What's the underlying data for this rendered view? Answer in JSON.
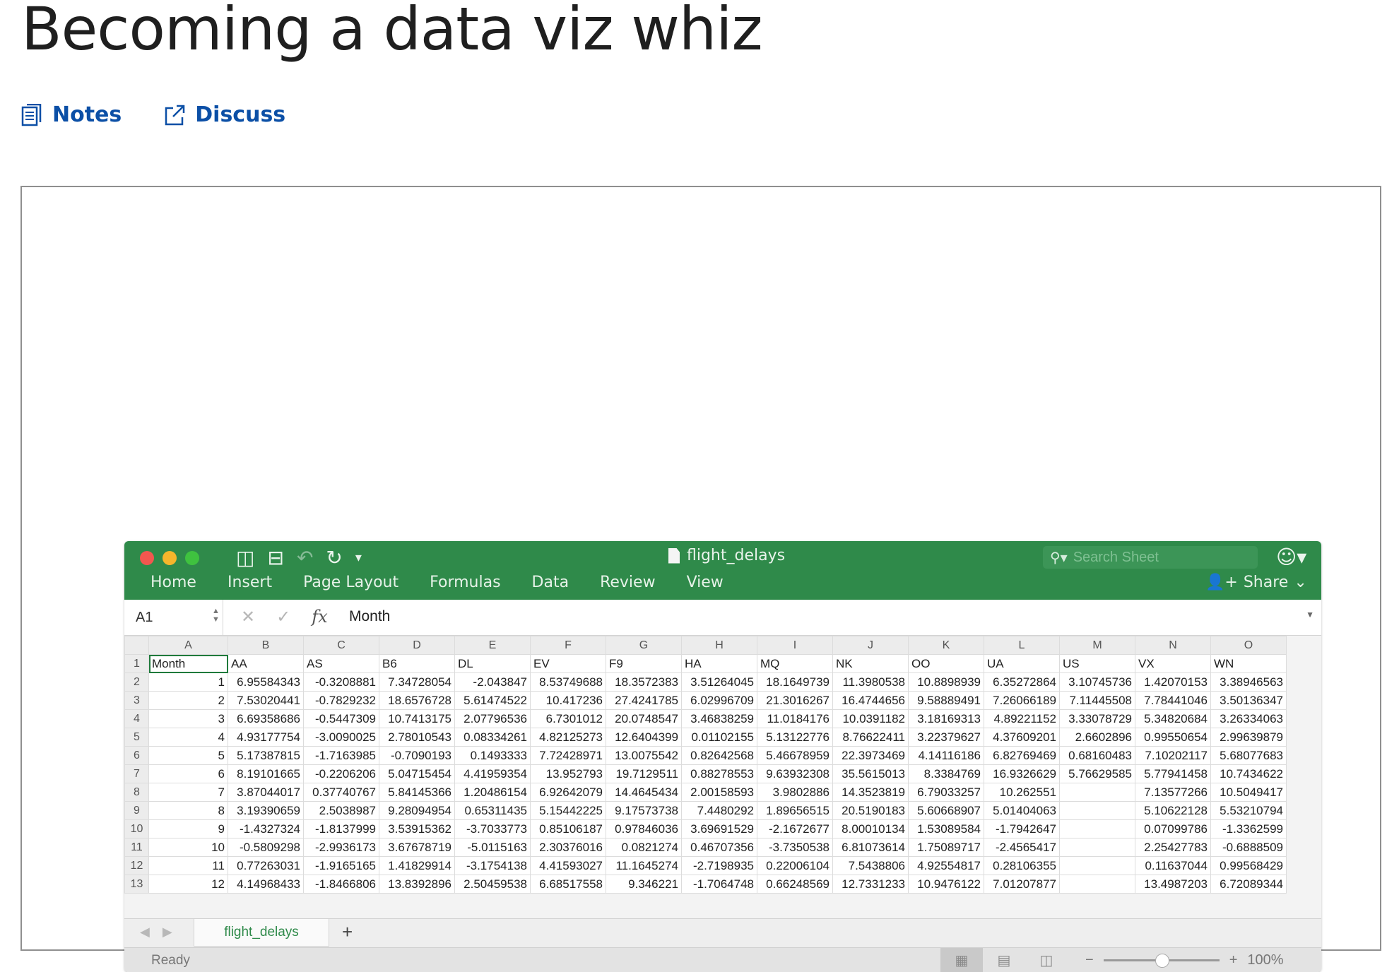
{
  "title": "Becoming a data viz whiz",
  "actions": {
    "notes": "Notes",
    "discuss": "Discuss"
  },
  "excel": {
    "file_name": "flight_delays",
    "search_placeholder": "Search Sheet",
    "ribbon_tabs": [
      "Home",
      "Insert",
      "Page Layout",
      "Formulas",
      "Data",
      "Review",
      "View"
    ],
    "share_label": "Share",
    "name_box": "A1",
    "formula_value": "Month",
    "column_letters": [
      "A",
      "B",
      "C",
      "D",
      "E",
      "F",
      "G",
      "H",
      "I",
      "J",
      "K",
      "L",
      "M",
      "N",
      "O"
    ],
    "rows": [
      [
        "1",
        "Month",
        "AA",
        "AS",
        "B6",
        "DL",
        "EV",
        "F9",
        "HA",
        "MQ",
        "NK",
        "OO",
        "UA",
        "US",
        "VX",
        "WN"
      ],
      [
        "2",
        "1",
        "6.95584343",
        "-0.3208881",
        "7.34728054",
        "-2.043847",
        "8.53749688",
        "18.3572383",
        "3.51264045",
        "18.1649739",
        "11.3980538",
        "10.8898939",
        "6.35272864",
        "3.10745736",
        "1.42070153",
        "3.38946563"
      ],
      [
        "3",
        "2",
        "7.53020441",
        "-0.7829232",
        "18.6576728",
        "5.61474522",
        "10.417236",
        "27.4241785",
        "6.02996709",
        "21.3016267",
        "16.4744656",
        "9.58889491",
        "7.26066189",
        "7.11445508",
        "7.78441046",
        "3.50136347"
      ],
      [
        "4",
        "3",
        "6.69358686",
        "-0.5447309",
        "10.7413175",
        "2.07796536",
        "6.7301012",
        "20.0748547",
        "3.46838259",
        "11.0184176",
        "10.0391182",
        "3.18169313",
        "4.89221152",
        "3.33078729",
        "5.34820684",
        "3.26334063"
      ],
      [
        "5",
        "4",
        "4.93177754",
        "-3.0090025",
        "2.78010543",
        "0.08334261",
        "4.82125273",
        "12.6404399",
        "0.01102155",
        "5.13122776",
        "8.76622411",
        "3.22379627",
        "4.37609201",
        "2.6602896",
        "0.99550654",
        "2.99639879"
      ],
      [
        "6",
        "5",
        "5.17387815",
        "-1.7163985",
        "-0.7090193",
        "0.1493333",
        "7.72428971",
        "13.0075542",
        "0.82642568",
        "5.46678959",
        "22.3973469",
        "4.14116186",
        "6.82769469",
        "0.68160483",
        "7.10202117",
        "5.68077683"
      ],
      [
        "7",
        "6",
        "8.19101665",
        "-0.2206206",
        "5.04715454",
        "4.41959354",
        "13.952793",
        "19.7129511",
        "0.88278553",
        "9.63932308",
        "35.5615013",
        "8.3384769",
        "16.9326629",
        "5.76629585",
        "5.77941458",
        "10.7434622"
      ],
      [
        "8",
        "7",
        "3.87044017",
        "0.37740767",
        "5.84145366",
        "1.20486154",
        "6.92642079",
        "14.4645434",
        "2.00158593",
        "3.9802886",
        "14.3523819",
        "6.79033257",
        "10.262551",
        "",
        "7.13577266",
        "10.5049417"
      ],
      [
        "9",
        "8",
        "3.19390659",
        "2.5038987",
        "9.28094954",
        "0.65311435",
        "5.15442225",
        "9.17573738",
        "7.4480292",
        "1.89656515",
        "20.5190183",
        "5.60668907",
        "5.01404063",
        "",
        "5.10622128",
        "5.53210794"
      ],
      [
        "10",
        "9",
        "-1.4327324",
        "-1.8137999",
        "3.53915362",
        "-3.7033773",
        "0.85106187",
        "0.97846036",
        "3.69691529",
        "-2.1672677",
        "8.00010134",
        "1.53089584",
        "-1.7942647",
        "",
        "0.07099786",
        "-1.3362599"
      ],
      [
        "11",
        "10",
        "-0.5809298",
        "-2.9936173",
        "3.67678719",
        "-5.0115163",
        "2.30376016",
        "0.0821274",
        "0.46707356",
        "-3.7350538",
        "6.81073614",
        "1.75089717",
        "-2.4565417",
        "",
        "2.25427783",
        "-0.6888509"
      ],
      [
        "12",
        "11",
        "0.77263031",
        "-1.9165165",
        "1.41829914",
        "-3.1754138",
        "4.41593027",
        "11.1645274",
        "-2.7198935",
        "0.22006104",
        "7.5438806",
        "4.92554817",
        "0.28106355",
        "",
        "0.11637044",
        "0.99568429"
      ],
      [
        "13",
        "12",
        "4.14968433",
        "-1.8466806",
        "13.8392896",
        "2.50459538",
        "6.68517558",
        "9.346221",
        "-1.7064748",
        "0.66248569",
        "12.7331233",
        "10.9476122",
        "7.01207877",
        "",
        "13.4987203",
        "6.72089344"
      ]
    ],
    "sheet_tab": "flight_delays",
    "status": "Ready",
    "zoom": "100%",
    "zoom_level": 0.5,
    "accent_color": "#2f8a4a"
  }
}
